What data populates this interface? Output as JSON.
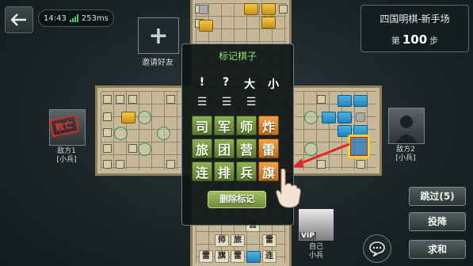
{
  "status": {
    "time": "14:43",
    "ping": "253ms"
  },
  "title_panel": {
    "title": "四国明棋-新手场",
    "step_prefix": "第",
    "step_number": "100",
    "step_suffix": "步"
  },
  "invite": {
    "icon": "+",
    "label": "邀请好友"
  },
  "players": {
    "left": {
      "name": "敌方1",
      "rank": "[小兵]",
      "stamp": "败亡"
    },
    "right": {
      "name": "敌方2",
      "rank": "[小兵]"
    },
    "self": {
      "name": "自己",
      "rank": "小兵",
      "badge": "VIP"
    }
  },
  "mark_dialog": {
    "title": "标记棋子",
    "symbols": [
      "!",
      "?",
      "大",
      "小"
    ],
    "dashes": [
      "☰",
      "☰",
      "☰"
    ],
    "pieces": [
      {
        "label": "司",
        "style": "green"
      },
      {
        "label": "军",
        "style": "green"
      },
      {
        "label": "师",
        "style": "green"
      },
      {
        "label": "炸",
        "style": "orange"
      },
      {
        "label": "旅",
        "style": "green"
      },
      {
        "label": "团",
        "style": "green"
      },
      {
        "label": "营",
        "style": "green"
      },
      {
        "label": "雷",
        "style": "orange"
      },
      {
        "label": "连",
        "style": "green"
      },
      {
        "label": "排",
        "style": "green"
      },
      {
        "label": "兵",
        "style": "green"
      },
      {
        "label": "旗",
        "style": "orange"
      }
    ],
    "delete_label": "删除标记"
  },
  "own_pieces": {
    "row0": [
      "营"
    ],
    "row1": [
      "师",
      "旅",
      "雷"
    ],
    "row2": [
      "雷",
      "旗",
      "雷",
      "连"
    ]
  },
  "side_buttons": {
    "skip": "跳过(5)",
    "surrender": "投降",
    "draw": "求和"
  },
  "icons": {
    "back": "back-arrow-icon",
    "chat": "chat-bubble-icon",
    "signal": "signal-bars-icon"
  },
  "colors": {
    "accent_green": "#8fe36e",
    "piece_orange": "#e8862b",
    "piece_green": "#78993f",
    "enemy_blue": "#2b9bd6"
  }
}
